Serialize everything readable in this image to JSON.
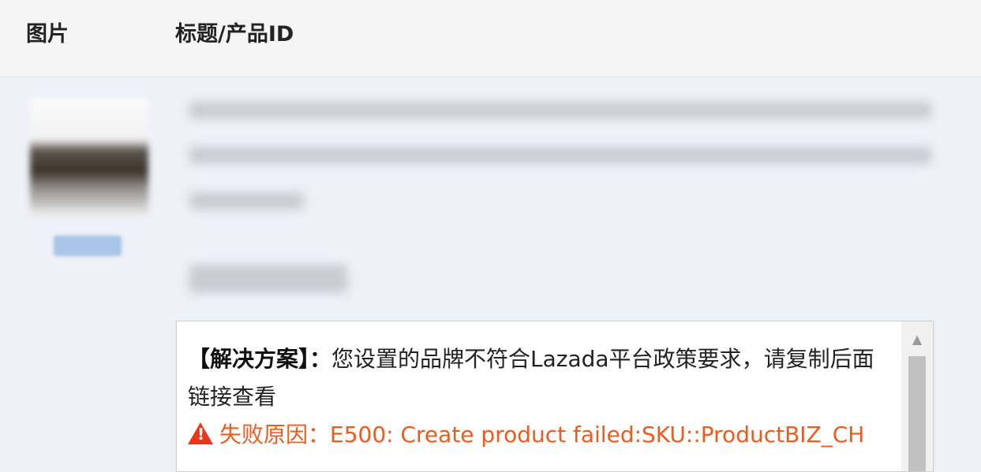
{
  "table": {
    "columns": {
      "image": "图片",
      "title_product_id": "标题/产品ID"
    }
  },
  "error_popup": {
    "solution_label": "【解决方案】：",
    "solution_text": "您设置的品牌不符合Lazada平台政策要求，请复制后面链接查看",
    "failure_label": "失败原因：",
    "failure_text": "E500: Create product failed:SKU::ProductBIZ_CH",
    "failure_color": "#f05a1c",
    "icon": "warning-triangle-icon"
  }
}
